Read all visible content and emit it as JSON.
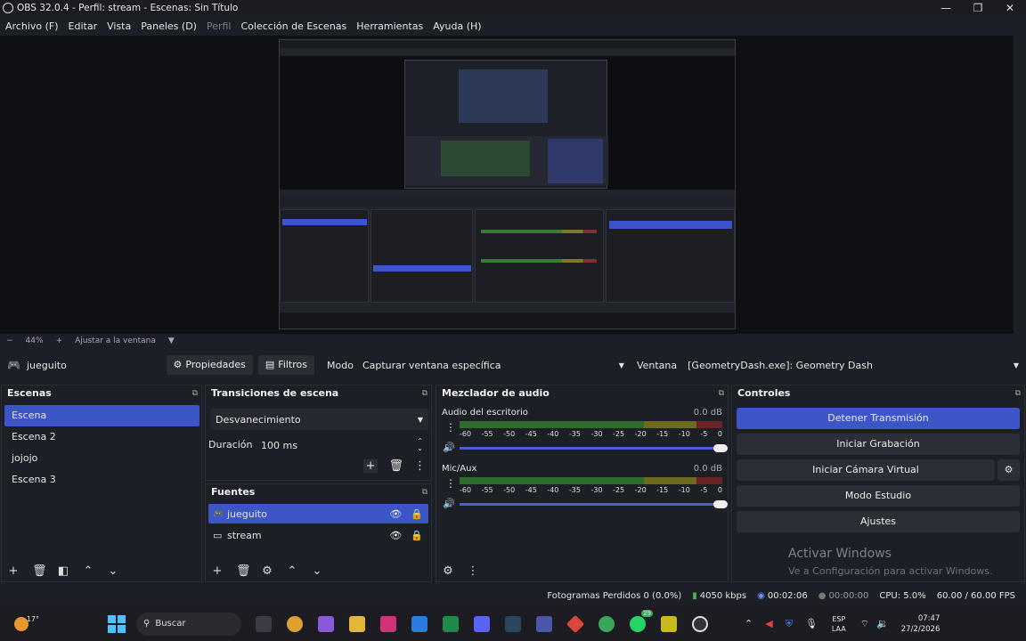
{
  "window": {
    "title": "OBS 32.0.4 - Perfil: stream - Escenas: Sin Título",
    "minimize": "—",
    "maximize": "❐",
    "close": "✕"
  },
  "menu": {
    "items": [
      "Archivo (F)",
      "Editar",
      "Vista",
      "Paneles (D)",
      "Perfil",
      "Colección de Escenas",
      "Herramientas",
      "Ayuda (H)"
    ]
  },
  "zoom": {
    "minus": "−",
    "level": "44%",
    "plus": "+",
    "fit_label": "Ajustar a la ventana",
    "dropdown": "▼"
  },
  "source_bar": {
    "source_name": "jueguito",
    "properties": "Propiedades",
    "filters": "Filtros",
    "mode_label": "Modo",
    "mode_value": "Capturar ventana específica",
    "window_label": "Ventana",
    "window_value": "[GeometryDash.exe]: Geometry Dash"
  },
  "scenes": {
    "header": "Escenas",
    "items": [
      "Escena",
      "Escena 2",
      "jojojo",
      "Escena 3"
    ],
    "selected_index": 0
  },
  "transitions": {
    "header": "Transiciones de escena",
    "transition_value": "Desvanecimiento",
    "duration_label": "Duración",
    "duration_value": "100 ms"
  },
  "sources": {
    "header": "Fuentes",
    "items": [
      {
        "name": "jueguito",
        "icon": "gamepad-icon",
        "selected": true
      },
      {
        "name": "stream",
        "icon": "monitor-icon",
        "selected": false
      }
    ]
  },
  "audio_mixer": {
    "header": "Mezclador de audio",
    "channels": [
      {
        "name": "Audio del escritorio",
        "db": "0.0 dB"
      },
      {
        "name": "Mic/Aux",
        "db": "0.0 dB"
      }
    ],
    "ticks": [
      "-60",
      "-55",
      "-50",
      "-45",
      "-40",
      "-35",
      "-30",
      "-25",
      "-20",
      "-15",
      "-10",
      "-5",
      "0"
    ]
  },
  "controls": {
    "header": "Controles",
    "stop_stream": "Detener Transmisión",
    "start_recording": "Iniciar Grabación",
    "start_virtual_cam": "Iniciar Cámara Virtual",
    "studio_mode": "Modo Estudio",
    "settings": "Ajustes"
  },
  "watermark": {
    "title": "Activar Windows",
    "subtitle": "Ve a Configuración para activar Windows."
  },
  "status": {
    "dropped_frames": "Fotogramas Perdidos 0 (0.0%)",
    "bitrate": "4050 kbps",
    "stream_time": "00:02:06",
    "record_time": "00:00:00",
    "cpu": "CPU: 5.0%",
    "fps": "60.00 / 60.00 FPS"
  },
  "taskbar": {
    "weather": "17°",
    "search_placeholder": "Buscar",
    "lang_line1": "ESP",
    "lang_line2": "LAA",
    "time": "07:47",
    "date": "27/2/2026",
    "badge_count": "29"
  },
  "colors": {
    "accent": "#3c56c8",
    "background": "#1d1f26",
    "meter_green": "#2f6d2f",
    "meter_yellow": "#6f6a21",
    "meter_red": "#6b2426"
  }
}
